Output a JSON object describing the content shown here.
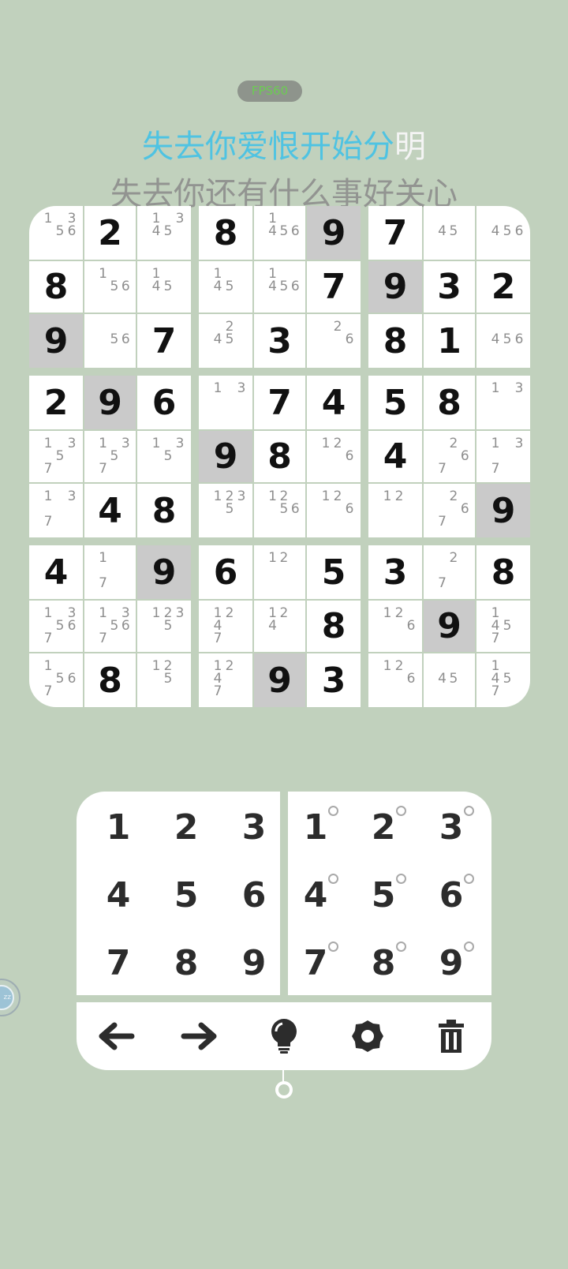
{
  "fps_label": "FPS60",
  "lyrics": {
    "line1_highlight": "失去你爱恨开始分",
    "line1_rest": "明",
    "line2": "失去你还有什么事好关心"
  },
  "board": [
    [
      {
        "n": [
          1,
          3,
          5,
          6
        ]
      },
      {
        "v": 2
      },
      {
        "n": [
          1,
          3,
          4,
          5
        ]
      },
      {
        "v": 8
      },
      {
        "n": [
          1,
          4,
          5,
          6
        ]
      },
      {
        "v": 9,
        "h": 1
      },
      {
        "v": 7
      },
      {
        "n": [
          4,
          5
        ]
      },
      {
        "n": [
          4,
          5,
          6
        ]
      }
    ],
    [
      {
        "v": 8
      },
      {
        "n": [
          1,
          5,
          6
        ]
      },
      {
        "n": [
          1,
          4,
          5
        ]
      },
      {
        "n": [
          1,
          4,
          5
        ]
      },
      {
        "n": [
          1,
          4,
          5,
          6
        ]
      },
      {
        "v": 7
      },
      {
        "v": 9,
        "h": 1
      },
      {
        "v": 3
      },
      {
        "v": 2
      }
    ],
    [
      {
        "v": 9,
        "h": 1
      },
      {
        "n": [
          5,
          6
        ]
      },
      {
        "v": 7
      },
      {
        "n": [
          2,
          4,
          5
        ]
      },
      {
        "v": 3
      },
      {
        "n": [
          2,
          6
        ]
      },
      {
        "v": 8
      },
      {
        "v": 1
      },
      {
        "n": [
          4,
          5,
          6
        ]
      }
    ],
    [
      {
        "v": 2
      },
      {
        "v": 9,
        "h": 1
      },
      {
        "v": 6
      },
      {
        "n": [
          1,
          3
        ]
      },
      {
        "v": 7
      },
      {
        "v": 4
      },
      {
        "v": 5
      },
      {
        "v": 8
      },
      {
        "n": [
          1,
          3
        ]
      }
    ],
    [
      {
        "n": [
          1,
          3,
          5,
          7
        ]
      },
      {
        "n": [
          1,
          3,
          5,
          7
        ]
      },
      {
        "n": [
          1,
          3,
          5
        ]
      },
      {
        "v": 9,
        "h": 1
      },
      {
        "v": 8
      },
      {
        "n": [
          1,
          2,
          6
        ]
      },
      {
        "v": 4
      },
      {
        "n": [
          2,
          6,
          7
        ]
      },
      {
        "n": [
          1,
          3,
          7
        ]
      }
    ],
    [
      {
        "n": [
          1,
          3,
          7
        ]
      },
      {
        "v": 4
      },
      {
        "v": 8
      },
      {
        "n": [
          1,
          2,
          3,
          5
        ]
      },
      {
        "n": [
          1,
          2,
          5,
          6
        ]
      },
      {
        "n": [
          1,
          2,
          6
        ]
      },
      {
        "n": [
          1,
          2
        ]
      },
      {
        "n": [
          2,
          6,
          7
        ]
      },
      {
        "v": 9,
        "h": 1
      }
    ],
    [
      {
        "v": 4
      },
      {
        "n": [
          1,
          7
        ]
      },
      {
        "v": 9,
        "h": 1
      },
      {
        "v": 6
      },
      {
        "n": [
          1,
          2
        ]
      },
      {
        "v": 5
      },
      {
        "v": 3
      },
      {
        "n": [
          2,
          7
        ]
      },
      {
        "v": 8
      }
    ],
    [
      {
        "n": [
          1,
          3,
          5,
          6,
          7
        ]
      },
      {
        "n": [
          1,
          3,
          5,
          6,
          7
        ]
      },
      {
        "n": [
          1,
          2,
          3,
          5
        ]
      },
      {
        "n": [
          1,
          2,
          4,
          7
        ]
      },
      {
        "n": [
          1,
          2,
          4
        ]
      },
      {
        "v": 8
      },
      {
        "n": [
          1,
          2,
          6
        ]
      },
      {
        "v": 9,
        "h": 1
      },
      {
        "n": [
          1,
          4,
          5,
          7
        ]
      }
    ],
    [
      {
        "n": [
          1,
          5,
          6,
          7
        ]
      },
      {
        "v": 8
      },
      {
        "n": [
          1,
          2,
          5
        ]
      },
      {
        "n": [
          1,
          2,
          4,
          7
        ]
      },
      {
        "v": 9,
        "h": 1
      },
      {
        "v": 3
      },
      {
        "n": [
          1,
          2,
          6
        ]
      },
      {
        "n": [
          4,
          5
        ]
      },
      {
        "n": [
          1,
          4,
          5,
          7
        ]
      }
    ]
  ],
  "keypad": {
    "numbers": [
      "1",
      "2",
      "3",
      "4",
      "5",
      "6",
      "7",
      "8",
      "9"
    ],
    "notes": [
      "1",
      "2",
      "3",
      "4",
      "5",
      "6",
      "7",
      "8",
      "9"
    ]
  },
  "toolbar": {
    "icons": [
      "arrow-left-icon",
      "arrow-right-icon",
      "lightbulb-icon",
      "gear-icon",
      "trash-icon"
    ]
  },
  "colors": {
    "background": "#c1d1bd",
    "highlight_cell": "#cacaca",
    "lyric_highlight": "#4fc3e2",
    "fps_text": "#6ccc52"
  }
}
